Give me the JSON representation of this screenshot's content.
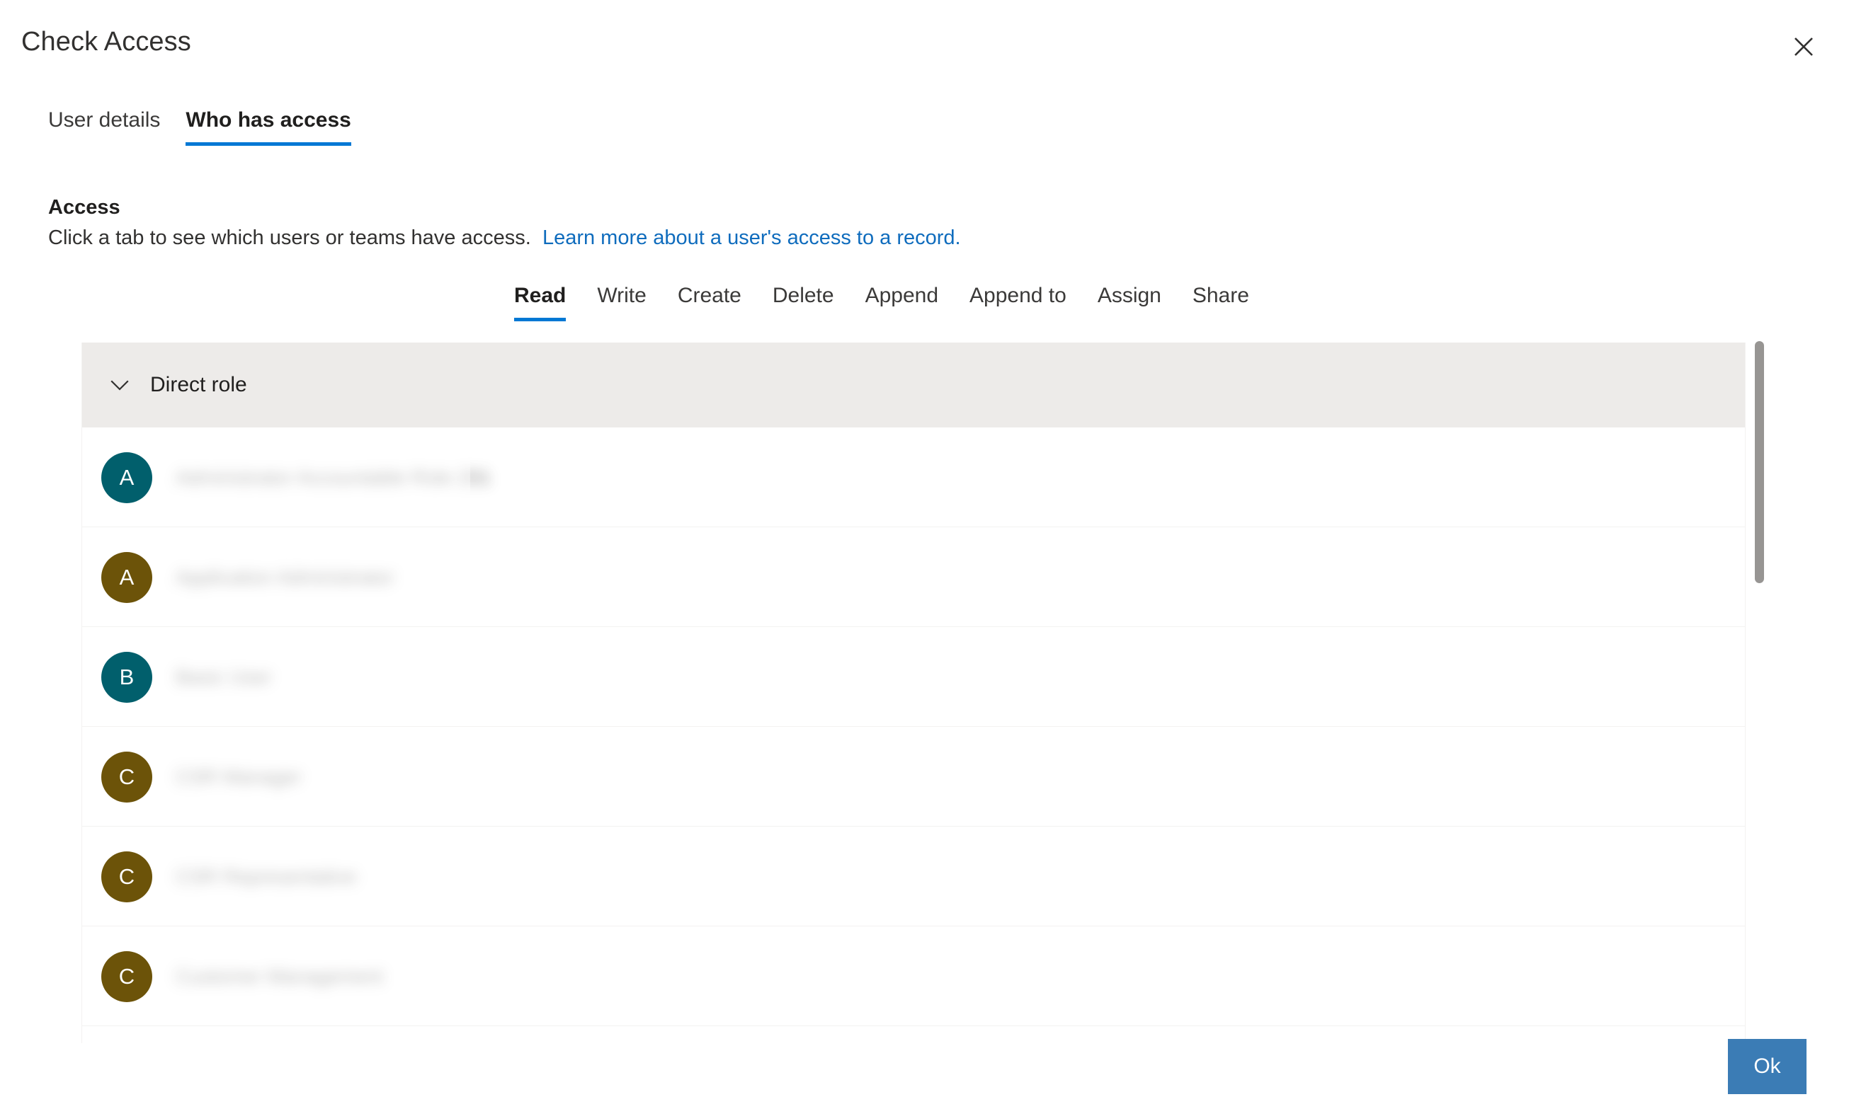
{
  "dialog": {
    "title": "Check Access",
    "close_icon": "close-icon"
  },
  "pivot_tabs": [
    {
      "label": "User details",
      "active": false
    },
    {
      "label": "Who has access",
      "active": true
    }
  ],
  "access_section": {
    "heading": "Access",
    "description_text": "Click a tab to see which users or teams have access.",
    "link_text": "Learn more about a user's access to a record."
  },
  "privilege_tabs": [
    {
      "label": "Read",
      "active": true
    },
    {
      "label": "Write",
      "active": false
    },
    {
      "label": "Create",
      "active": false
    },
    {
      "label": "Delete",
      "active": false
    },
    {
      "label": "Append",
      "active": false
    },
    {
      "label": "Append to",
      "active": false
    },
    {
      "label": "Assign",
      "active": false
    },
    {
      "label": "Share",
      "active": false
    }
  ],
  "group": {
    "label": "Direct role",
    "chevron_icon": "chevron-down-icon",
    "expanded": true
  },
  "rows": [
    {
      "initial": "A",
      "avatar_color": "#015f6c",
      "name": "Administrator Accountable Role 201",
      "name_width": 258
    },
    {
      "initial": "A",
      "avatar_color": "#6c5309",
      "name": "Application Administrator",
      "name_width": 228
    },
    {
      "initial": "B",
      "avatar_color": "#015f6c",
      "name": "Basic User",
      "name_width": 70
    },
    {
      "initial": "C",
      "avatar_color": "#6c5309",
      "name": "CSR Manager",
      "name_width": 112
    },
    {
      "initial": "C",
      "avatar_color": "#6c5309",
      "name": "CSR Representative",
      "name_width": 168
    },
    {
      "initial": "C",
      "avatar_color": "#6c5309",
      "name": "Customer Management",
      "name_width": 184
    }
  ],
  "scrollbar": {
    "thumb_color": "#979593"
  },
  "footer": {
    "ok_label": "Ok",
    "ok_color": "#3b7cb5"
  },
  "colors": {
    "accent": "#0078d4",
    "link": "#0f6cbd",
    "group_header_bg": "#edebe9",
    "row_divider": "#f3f2f1"
  }
}
